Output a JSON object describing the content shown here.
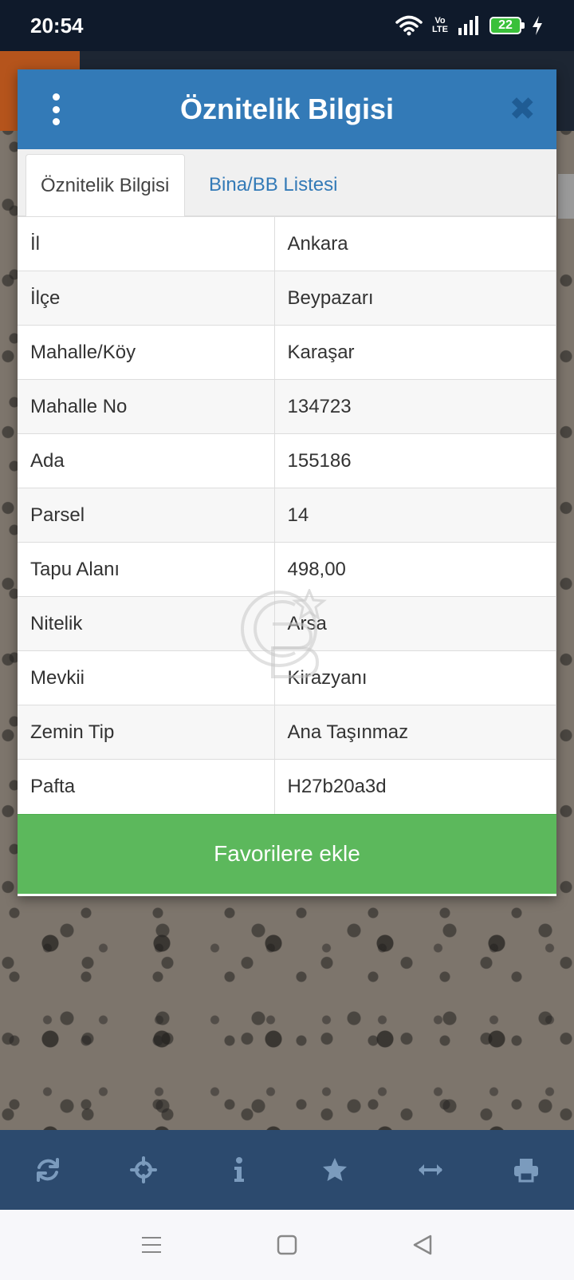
{
  "status_bar": {
    "time": "20:54",
    "network_label_top": "Vo",
    "network_label_bottom": "LTE",
    "battery_level": "22"
  },
  "modal": {
    "title": "Öznitelik Bilgisi",
    "close_glyph": "✖",
    "tabs": [
      {
        "label": "Öznitelik Bilgisi",
        "active": true
      },
      {
        "label": "Bina/BB Listesi",
        "active": false
      }
    ],
    "rows": [
      {
        "key": "İl",
        "value": "Ankara"
      },
      {
        "key": "İlçe",
        "value": "Beypazarı"
      },
      {
        "key": "Mahalle/Köy",
        "value": "Karaşar"
      },
      {
        "key": "Mahalle No",
        "value": "134723"
      },
      {
        "key": "Ada",
        "value": "155186"
      },
      {
        "key": "Parsel",
        "value": "14"
      },
      {
        "key": "Tapu Alanı",
        "value": "498,00"
      },
      {
        "key": "Nitelik",
        "value": "Arsa"
      },
      {
        "key": "Mevkii",
        "value": "Kirazyanı"
      },
      {
        "key": "Zemin Tip",
        "value": "Ana Taşınmaz"
      },
      {
        "key": "Pafta",
        "value": "H27b20a3d"
      }
    ],
    "favorite_button": "Favorilere ekle"
  },
  "toolbar_icons": [
    "refresh-icon",
    "locate-icon",
    "info-icon",
    "star-icon",
    "measure-icon",
    "print-icon"
  ],
  "colors": {
    "header": "#337ab7",
    "favorite": "#5cb85c",
    "toolbar": "#2c4a6e",
    "status_bar": "#0f1a2b"
  }
}
